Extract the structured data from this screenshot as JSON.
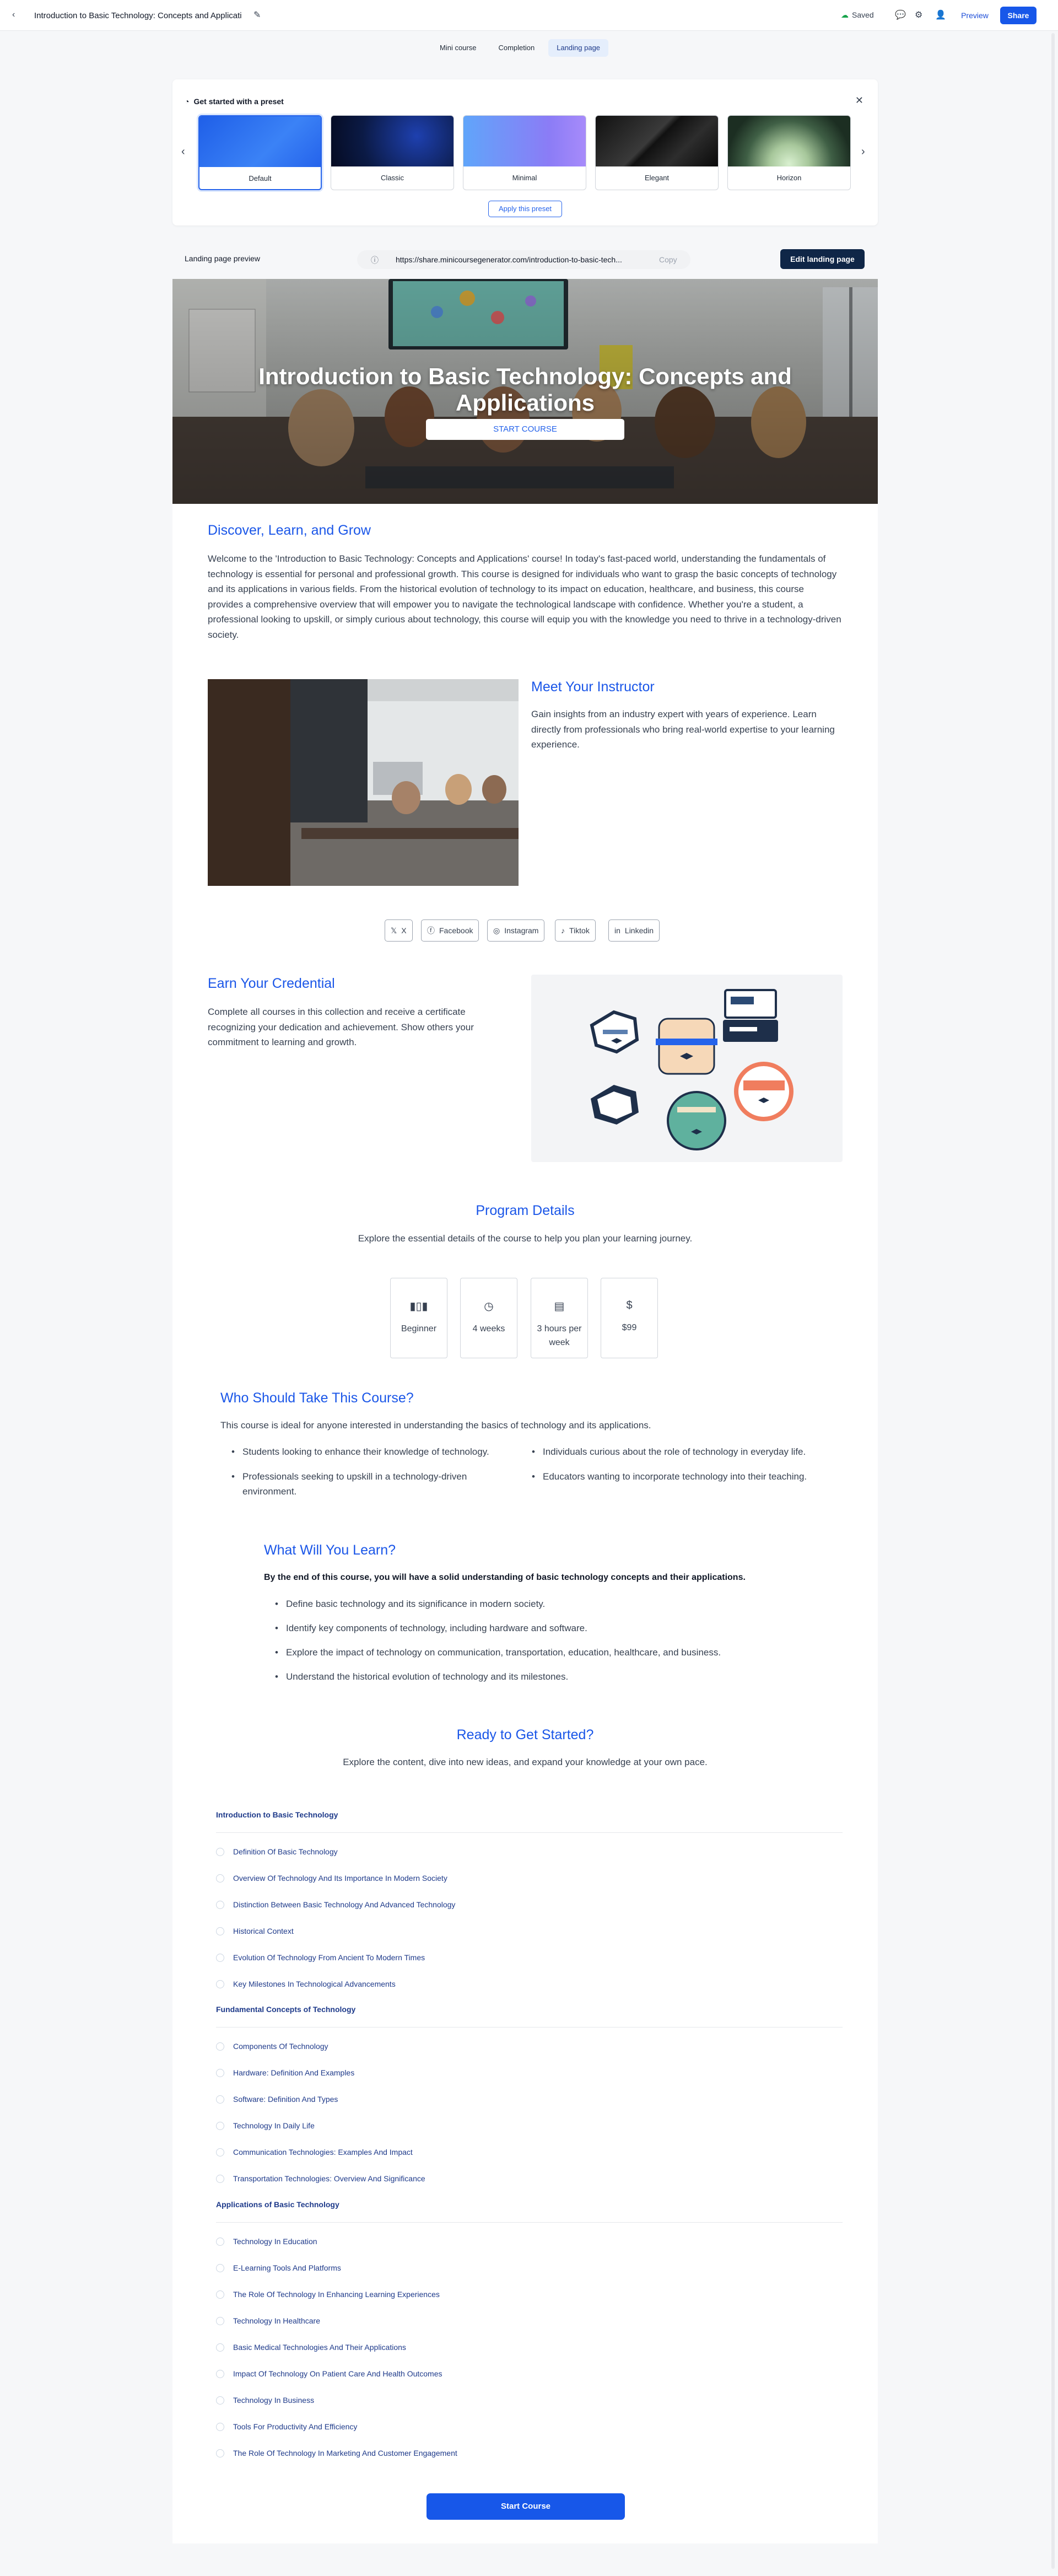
{
  "topbar": {
    "back": "‹",
    "title": "Introduction to Basic Technology: Concepts and Applicati",
    "saved": "Saved",
    "preview": "Preview",
    "share": "Share"
  },
  "tabs": [
    "Mini course",
    "Completion",
    "Landing page"
  ],
  "preset": {
    "title": "Get started with a preset",
    "tiles": [
      "Default",
      "Classic",
      "Minimal",
      "Elegant",
      "Horizon"
    ],
    "apply": "Apply this preset"
  },
  "preview_bar": {
    "label": "Landing page preview",
    "url": "https://share.minicoursegenerator.com/introduction-to-basic-tech...",
    "copy": "Copy",
    "edit": "Edit landing page"
  },
  "hero": {
    "title": "Introduction to Basic Technology: Concepts and Applications",
    "button": "START COURSE"
  },
  "discover": {
    "title": "Discover, Learn, and Grow",
    "body": "Welcome to the 'Introduction to Basic Technology: Concepts and Applications' course! In today's fast-paced world, understanding the fundamentals of technology is essential for personal and professional growth. This course is designed for individuals who want to grasp the basic concepts of technology and its applications in various fields. From the historical evolution of technology to its impact on education, healthcare, and business, this course provides a comprehensive overview that will empower you to navigate the technological landscape with confidence. Whether you're a student, a professional looking to upskill, or simply curious about technology, this course will equip you with the knowledge you need to thrive in a technology-driven society."
  },
  "instructor": {
    "title": "Meet Your Instructor",
    "body": "Gain insights from an industry expert with years of experience. Learn directly from professionals who bring real-world expertise to your learning experience."
  },
  "social": [
    "X",
    "Facebook",
    "Instagram",
    "Tiktok",
    "Linkedin"
  ],
  "credential": {
    "title": "Earn Your Credential",
    "body": "Complete all courses in this collection and receive a certificate recognizing your dedication and achievement. Show others your commitment to learning and growth."
  },
  "program": {
    "title": "Program Details",
    "subtitle": "Explore the essential details of the course to help you plan your learning journey.",
    "stats": [
      "Beginner",
      "4 weeks",
      "3 hours per week",
      "$99"
    ]
  },
  "who": {
    "title": "Who Should Take This Course?",
    "intro": "This course is ideal for anyone interested in understanding the basics of technology and its applications.",
    "left": [
      "Students looking to enhance their knowledge of technology.",
      "Professionals seeking to upskill in a technology-driven environment."
    ],
    "right": [
      "Individuals curious about the role of technology in everyday life.",
      "Educators wanting to incorporate technology into their teaching."
    ]
  },
  "learn": {
    "title": "What Will You Learn?",
    "intro": "By the end of this course, you will have a solid understanding of basic technology concepts and their applications.",
    "items": [
      "Define basic technology and its significance in modern society.",
      "Identify key components of technology, including hardware and software.",
      "Explore the impact of technology on communication, transportation, education, healthcare, and business.",
      "Understand the historical evolution of technology and its milestones."
    ]
  },
  "ready": {
    "title": "Ready to Get Started?",
    "subtitle": "Explore the content, dive into new ideas, and expand your knowledge at your own pace."
  },
  "sections": [
    {
      "title": "Introduction to Basic Technology",
      "lessons": [
        "Definition Of Basic Technology",
        "Overview Of Technology And Its Importance In Modern Society",
        "Distinction Between Basic Technology And Advanced Technology",
        "Historical Context",
        "Evolution Of Technology From Ancient To Modern Times",
        "Key Milestones In Technological Advancements"
      ]
    },
    {
      "title": "Fundamental Concepts of Technology",
      "lessons": [
        "Components Of Technology",
        "Hardware: Definition And Examples",
        "Software: Definition And Types",
        "Technology In Daily Life",
        "Communication Technologies: Examples And Impact",
        "Transportation Technologies: Overview And Significance"
      ]
    },
    {
      "title": "Applications of Basic Technology",
      "lessons": [
        "Technology In Education",
        "E-Learning Tools And Platforms",
        "The Role Of Technology In Enhancing Learning Experiences",
        "Technology In Healthcare",
        "Basic Medical Technologies And Their Applications",
        "Impact Of Technology On Patient Care And Health Outcomes",
        "Technology In Business",
        "Tools For Productivity And Efficiency",
        "The Role Of Technology In Marketing And Customer Engagement"
      ]
    }
  ],
  "start_button": "Start Course",
  "colors": {
    "accent": "#1757e9",
    "heading_blue": "#1a56e8",
    "dark_button": "#0f2647"
  }
}
